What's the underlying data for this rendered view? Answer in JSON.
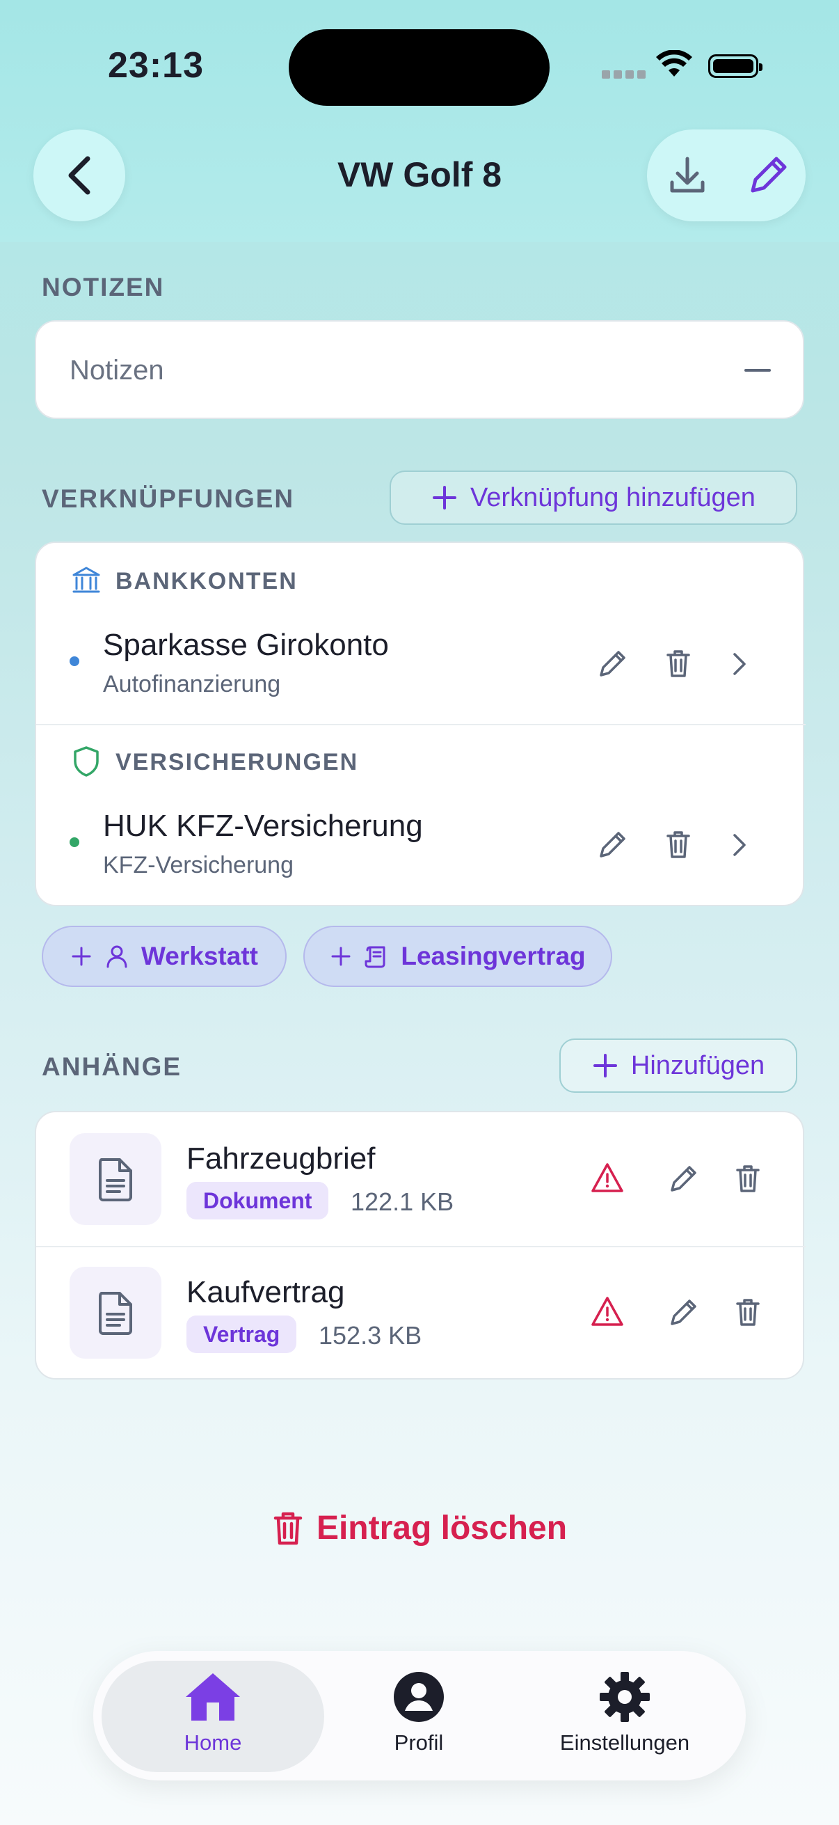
{
  "status_bar": {
    "time": "23:13"
  },
  "header": {
    "title": "VW Golf 8"
  },
  "notes": {
    "section_label": "NOTIZEN",
    "placeholder": "Notizen"
  },
  "links": {
    "section_label": "VERKNÜPFUNGEN",
    "add_label": "Verknüpfung hinzufügen",
    "groups": [
      {
        "label": "BANKKONTEN",
        "icon": "bank-icon",
        "accent": "#3f86d8",
        "item": {
          "title": "Sparkasse Girokonto",
          "subtitle": "Autofinanzierung"
        }
      },
      {
        "label": "VERSICHERUNGEN",
        "icon": "shield-icon",
        "accent": "#33a667",
        "item": {
          "title": "HUK KFZ-Versicherung",
          "subtitle": "KFZ-Versicherung"
        }
      }
    ],
    "chips": [
      {
        "label": "Werkstatt",
        "icon": "person-icon"
      },
      {
        "label": "Leasingvertrag",
        "icon": "scroll-icon"
      }
    ]
  },
  "attachments": {
    "section_label": "ANHÄNGE",
    "add_label": "Hinzufügen",
    "items": [
      {
        "name": "Fahrzeugbrief",
        "tag": "Dokument",
        "size": "122.1 KB"
      },
      {
        "name": "Kaufvertrag",
        "tag": "Vertrag",
        "size": "152.3 KB"
      }
    ]
  },
  "delete_label": "Eintrag löschen",
  "tabs": [
    {
      "label": "Home",
      "icon": "home-icon",
      "active": true
    },
    {
      "label": "Profil",
      "icon": "profile-icon",
      "active": false
    },
    {
      "label": "Einstellungen",
      "icon": "settings-gear-icon",
      "active": false
    }
  ],
  "colors": {
    "accent": "#6d35d9",
    "danger": "#d6204f",
    "warning": "#d6204f"
  }
}
